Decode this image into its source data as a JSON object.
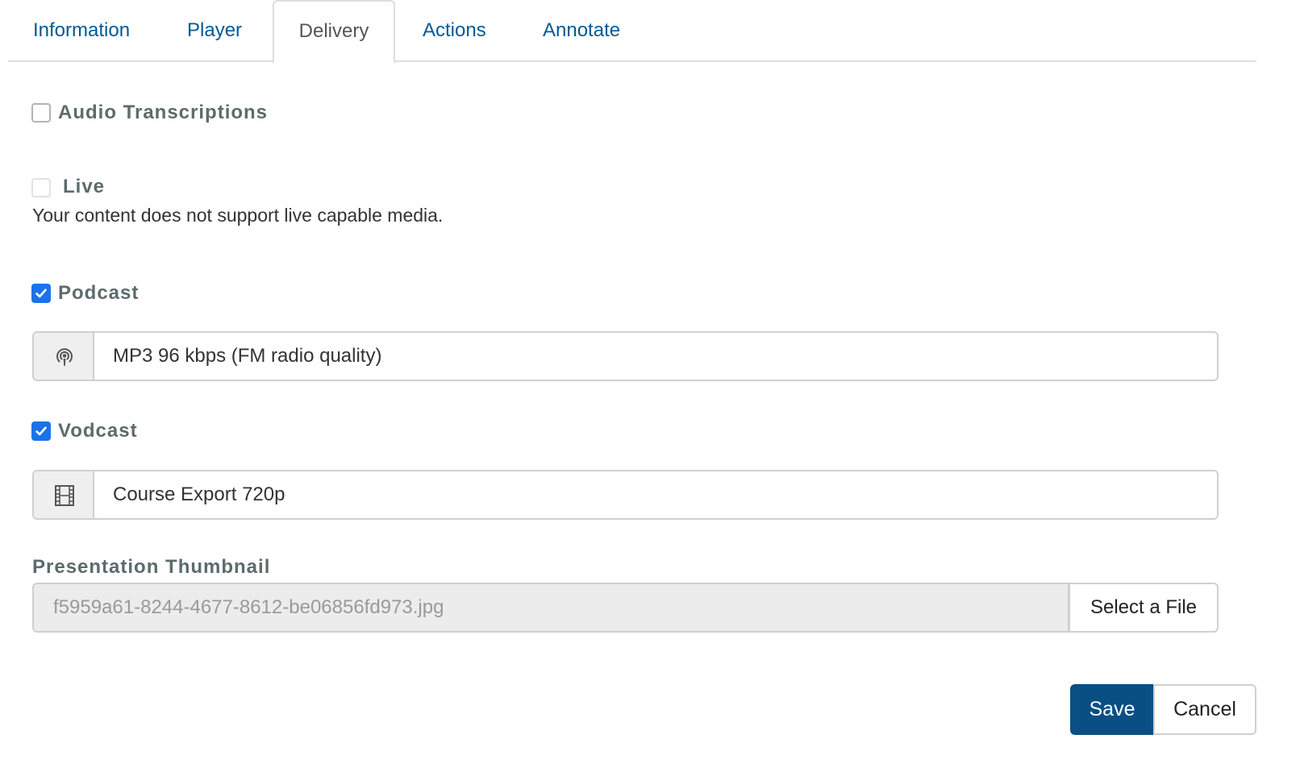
{
  "tabs": [
    {
      "label": "Information"
    },
    {
      "label": "Player"
    },
    {
      "label": "Delivery"
    },
    {
      "label": "Actions"
    },
    {
      "label": "Annotate"
    }
  ],
  "active_tab": "Delivery",
  "audio_transcriptions": {
    "label": "Audio Transcriptions",
    "checked": false
  },
  "live": {
    "label": "Live",
    "checked": false,
    "disabled": true,
    "help": "Your content does not support live capable media."
  },
  "podcast": {
    "label": "Podcast",
    "checked": true,
    "value": "MP3 96 kbps (FM radio quality)",
    "icon": "podcast-icon"
  },
  "vodcast": {
    "label": "Vodcast",
    "checked": true,
    "value": "Course Export 720p",
    "icon": "film-icon"
  },
  "thumbnail": {
    "label": "Presentation Thumbnail",
    "value": "f5959a61-8244-4677-8612-be06856fd973.jpg",
    "button": "Select a File"
  },
  "footer": {
    "save": "Save",
    "cancel": "Cancel"
  },
  "colors": {
    "link": "#005a96",
    "checkbox_checked": "#1a73e8",
    "primary_button": "#0a4f84"
  }
}
